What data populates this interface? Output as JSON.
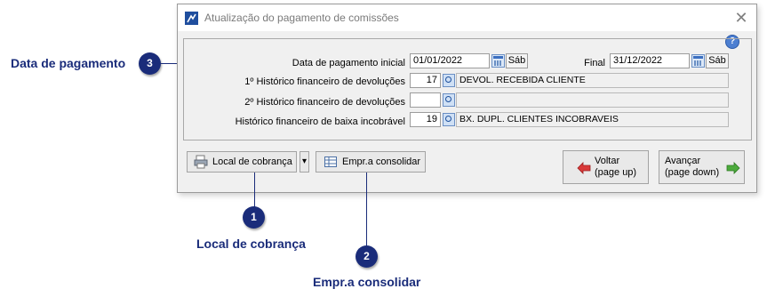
{
  "window": {
    "title": "Atualização do pagamento de comissões",
    "close_glyph": "✕",
    "help_glyph": "?"
  },
  "form": {
    "date_start_label": "Data de pagamento inicial",
    "date_start_value": "01/01/2022",
    "date_start_day": "Sáb",
    "date_end_label": "Final",
    "date_end_value": "31/12/2022",
    "date_end_day": "Sáb",
    "hist1_label": "1º Histórico financeiro de devoluções",
    "hist1_code": "17",
    "hist1_desc": "DEVOL.  RECEBIDA CLIENTE",
    "hist2_label": "2º Histórico financeiro de devoluções",
    "hist2_code": "",
    "hist2_desc": "",
    "hist3_label": "Histórico financeiro de baixa incobrável",
    "hist3_code": "19",
    "hist3_desc": "BX. DUPL. CLIENTES INCOBRAVEIS"
  },
  "buttons": {
    "local_cobranca": "Local de cobrança",
    "dropdown_glyph": "▾",
    "empr_consolidar": "Empr.a consolidar",
    "voltar_line1": "Voltar",
    "voltar_line2": "(page up)",
    "avancar_line1": "Avançar",
    "avancar_line2": "(page down)"
  },
  "annotations": {
    "badge1": "1",
    "label1": "Local de cobrança",
    "badge2": "2",
    "label2": "Empr.a consolidar",
    "badge3": "3",
    "label3": "Data de pagamento"
  },
  "colors": {
    "callout": "#1a2c7a",
    "arrow_left": "#d93a3a",
    "arrow_right": "#4caa3c"
  }
}
